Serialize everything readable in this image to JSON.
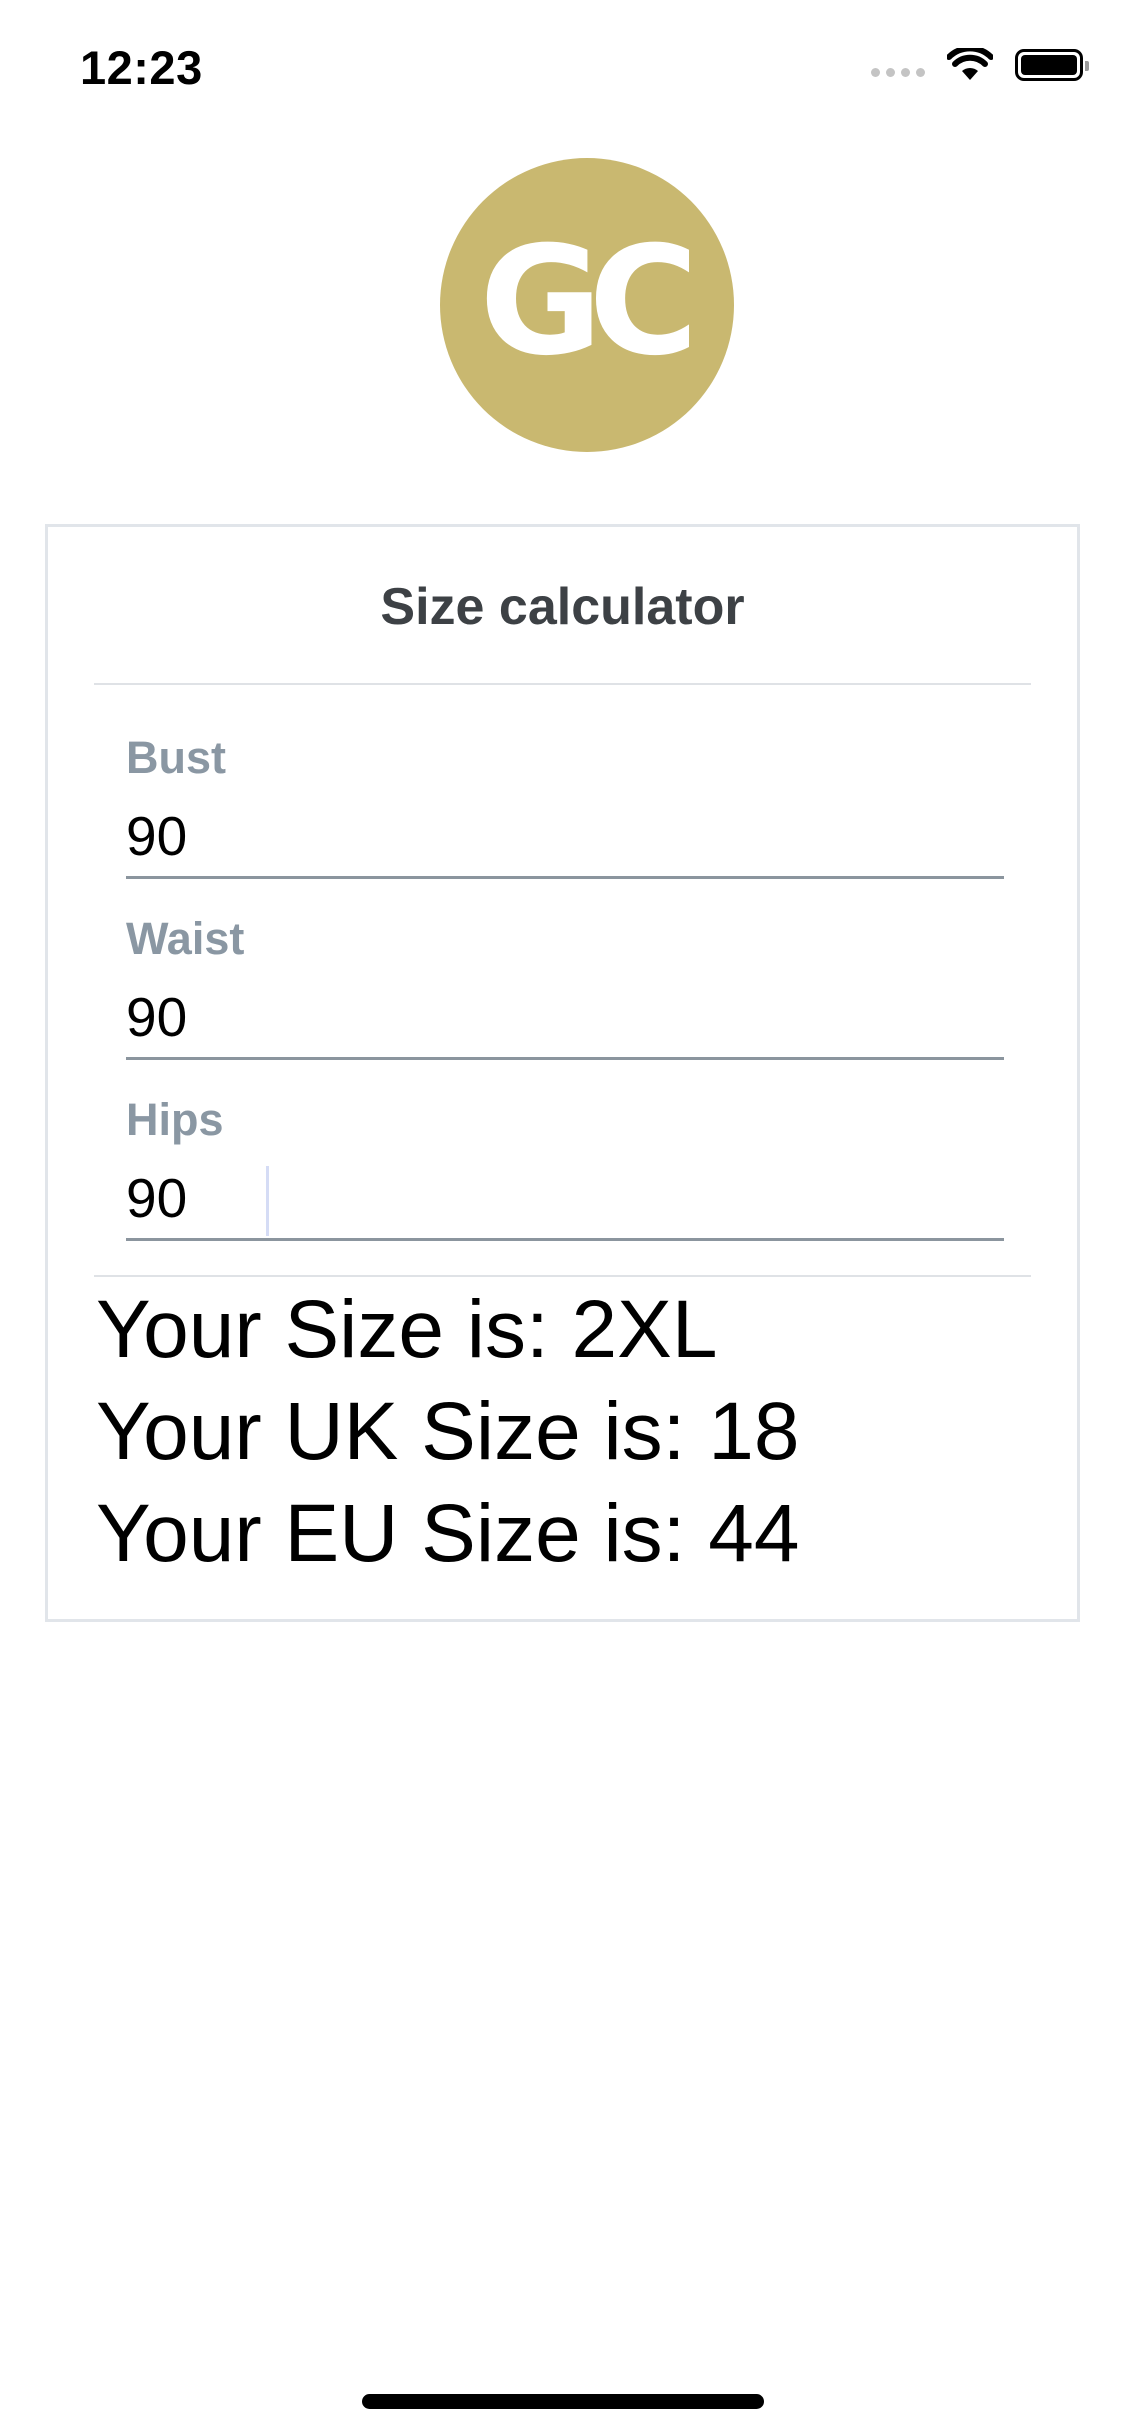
{
  "status_bar": {
    "time": "12:23",
    "icons": [
      "signal-dots-icon",
      "wifi-icon",
      "battery-icon"
    ]
  },
  "logo": {
    "text": "GC",
    "color": "#c9b870"
  },
  "card": {
    "title": "Size calculator",
    "fields": [
      {
        "label": "Bust",
        "value": "90"
      },
      {
        "label": "Waist",
        "value": "90"
      },
      {
        "label": "Hips",
        "value": "90"
      }
    ],
    "results": {
      "size": "Your Size is: 2XL",
      "uk_size": "Your UK Size is: 18",
      "eu_size": "Your EU Size is: 44"
    }
  },
  "colors": {
    "label": "#8a97a3",
    "title": "#3d4145",
    "underline": "#8b959e",
    "card_border": "#e1e5ea"
  }
}
